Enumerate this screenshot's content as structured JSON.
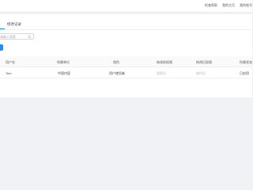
{
  "topbar": {
    "links": [
      "检查帮助",
      "我的主页",
      "我的账号"
    ]
  },
  "tabs": [
    {
      "label": "修改记录"
    }
  ],
  "search": {
    "placeholder": "请输入搜索",
    "value": ""
  },
  "table": {
    "columns": [
      "用户名",
      "所属单位",
      "角色",
      "修改前权限",
      "修改后权限",
      "所属状态"
    ],
    "rows": [
      [
        "Tom",
        "中国内容",
        "用户使用者",
        "管理员",
        "操作员",
        "已启用"
      ]
    ]
  },
  "colors": {
    "accent": "#1890ff",
    "background": "#f0f2f5"
  }
}
